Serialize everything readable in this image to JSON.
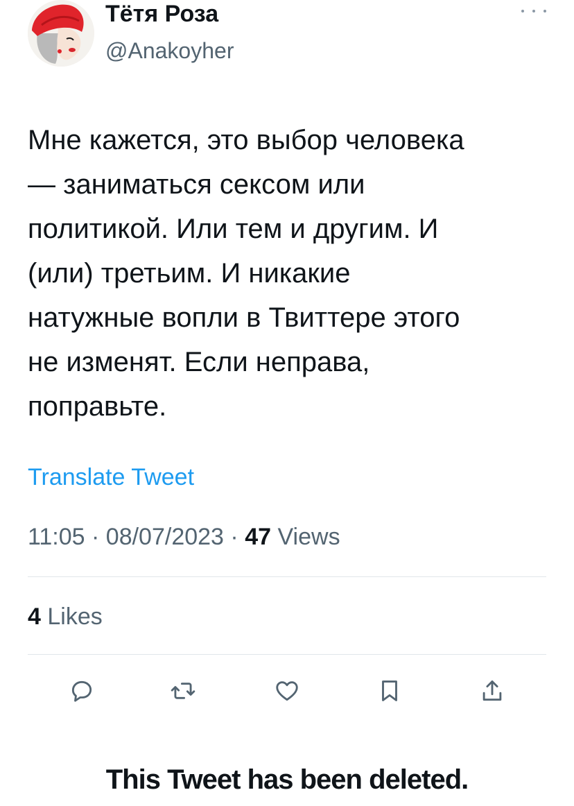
{
  "author": {
    "display_name": "Тётя Роза",
    "handle": "@Anakoyher",
    "avatar_icon": "avatar-illustration-red-turban"
  },
  "tweet": {
    "text": "Мне кажется, это выбор человека\n— заниматься сексом или\nполитикой. Или тем и другим. И\n(или) третьим. И никакие\nнатужные вопли в Твиттере этого\nне изменят. Если неправа,\nпоправьте.",
    "translate_label": "Translate Tweet",
    "time": "11:05",
    "date": "08/07/2023",
    "separator": "·",
    "views_count": "47",
    "views_label": "Views",
    "likes_count": "4",
    "likes_label": "Likes"
  },
  "actions": [
    {
      "name": "reply",
      "icon": "reply-icon"
    },
    {
      "name": "retweet",
      "icon": "retweet-icon"
    },
    {
      "name": "like",
      "icon": "heart-icon"
    },
    {
      "name": "bookmark",
      "icon": "bookmark-icon"
    },
    {
      "name": "share",
      "icon": "share-icon"
    }
  ],
  "notice": {
    "deleted_text": "This Tweet has been deleted."
  },
  "colors": {
    "accent": "#1d9bf0",
    "secondary_text": "#536471",
    "primary_text": "#0f1419",
    "divider": "#e1e6ea"
  }
}
